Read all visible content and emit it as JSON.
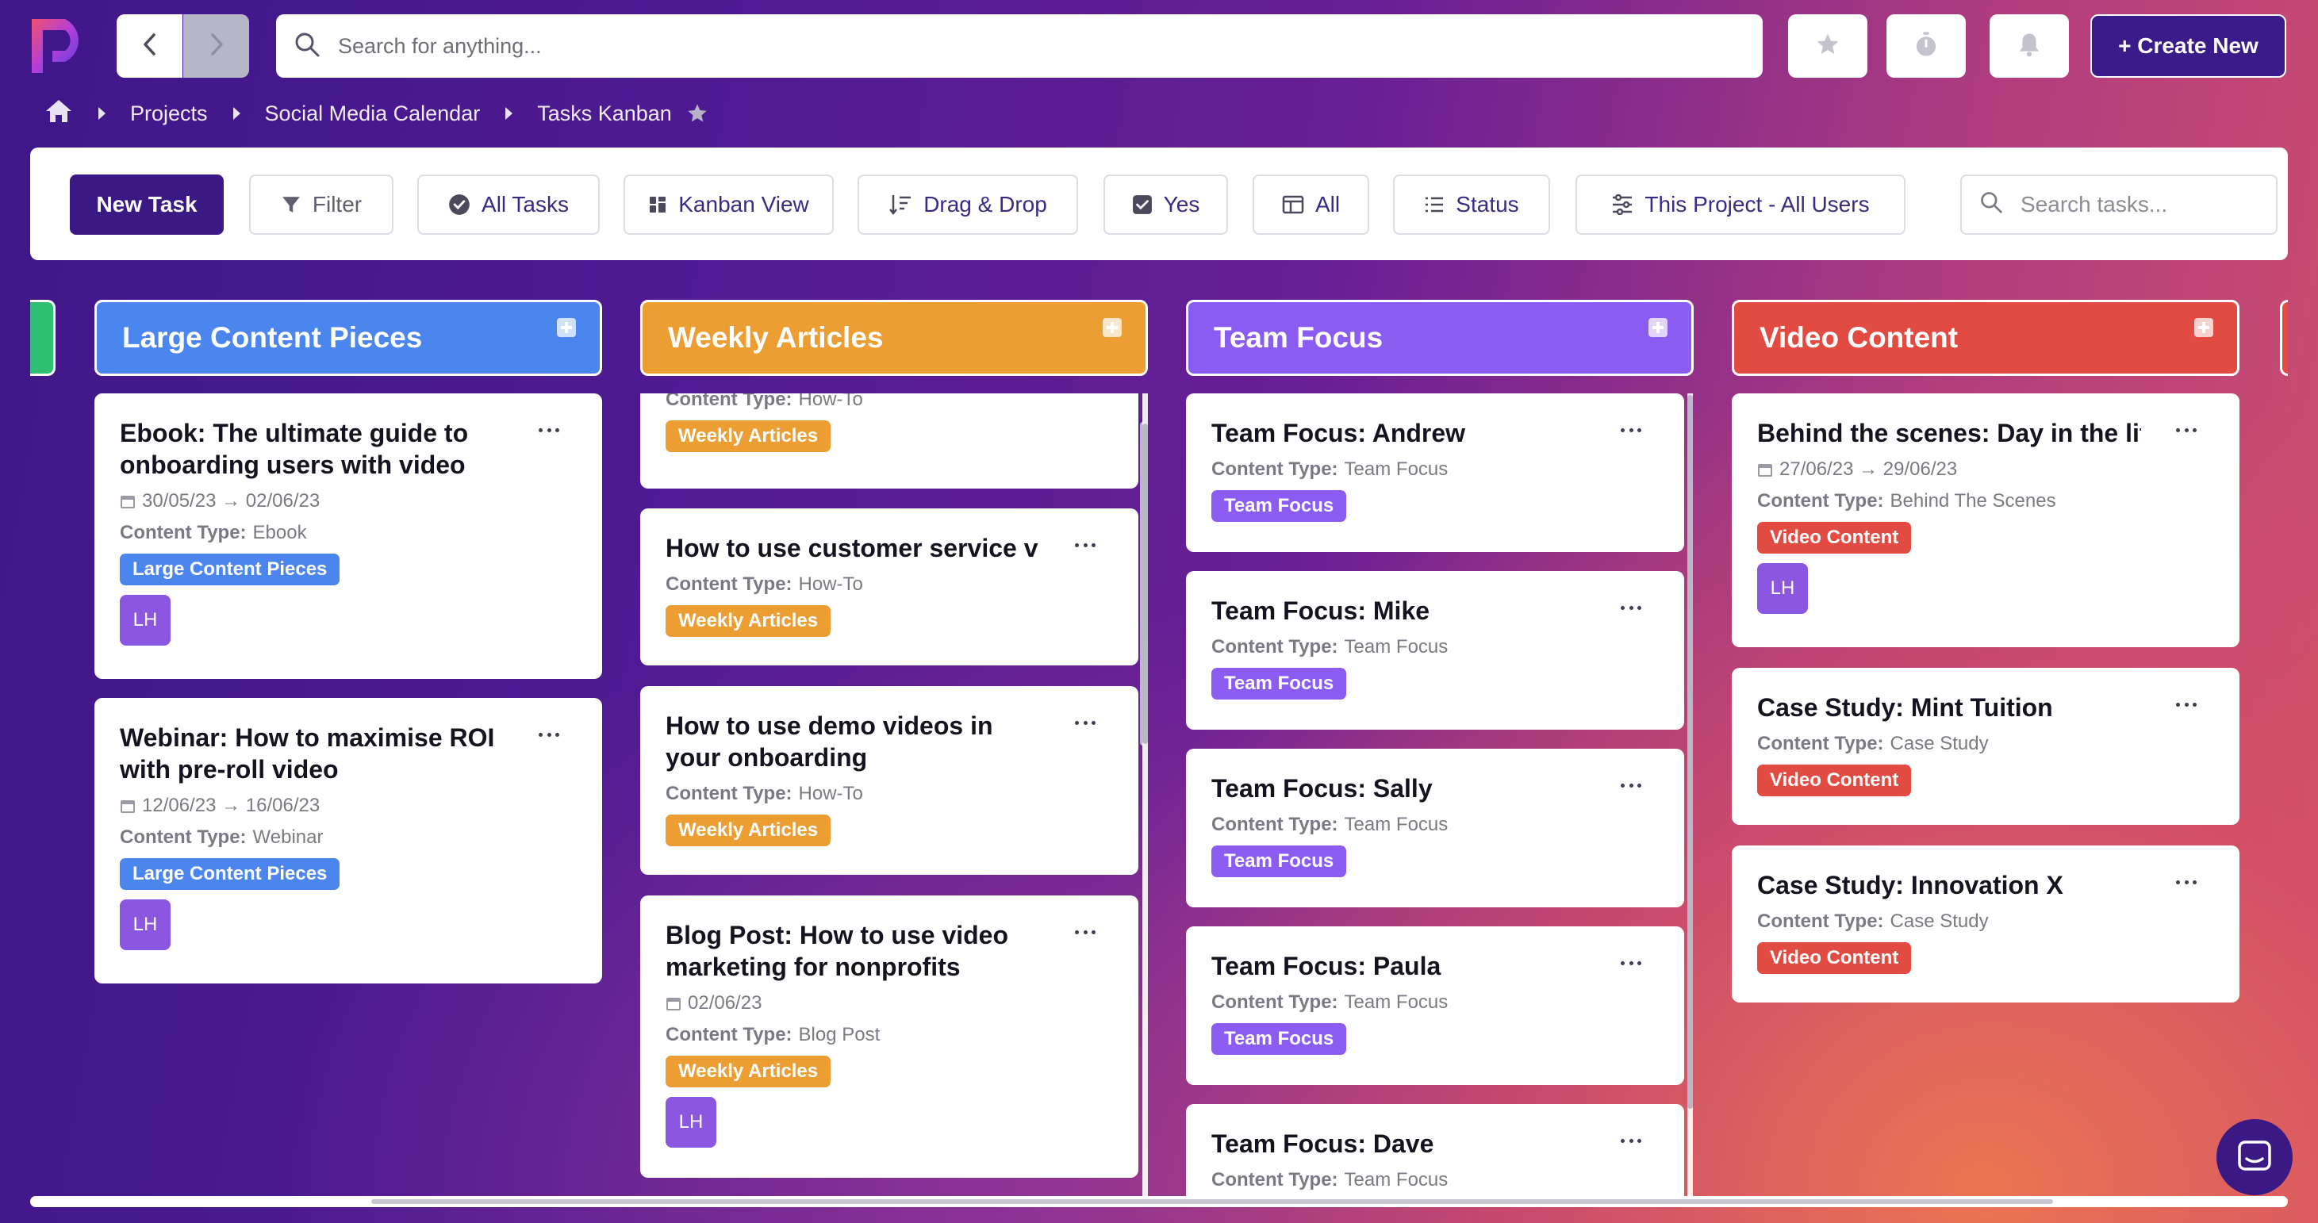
{
  "header": {
    "search_placeholder": "Search for anything...",
    "create_label": "+ Create New"
  },
  "breadcrumb": {
    "items": [
      "Projects",
      "Social Media Calendar",
      "Tasks Kanban"
    ]
  },
  "toolbar": {
    "new_task": "New Task",
    "filter": "Filter",
    "all_tasks": "All Tasks",
    "kanban_view": "Kanban View",
    "drag_drop": "Drag & Drop",
    "yes": "Yes",
    "all": "All",
    "status": "Status",
    "scope": "This Project - All Users",
    "search_placeholder": "Search tasks..."
  },
  "labels": {
    "content_type": "Content Type:"
  },
  "colors": {
    "large": "#4b86ee",
    "weekly": "#ec9e32",
    "team": "#8a5cf2",
    "video": "#e24b41",
    "peek_left": "#2fbf72",
    "brand": "#3a1985"
  },
  "columns": [
    {
      "title": "Large Content Pieces",
      "cards": [
        {
          "title": "Ebook: The ultimate guide to onboarding users with video",
          "dates": "30/05/23 → 02/06/23",
          "type": "Ebook",
          "tag": "Large Content Pieces",
          "avatar": "LH"
        },
        {
          "title": "Webinar: How to maximise ROI with pre-roll video",
          "dates": "12/06/23 → 16/06/23",
          "type": "Webinar",
          "tag": "Large Content Pieces",
          "avatar": "LH"
        }
      ]
    },
    {
      "title": "Weekly Articles",
      "cards": [
        {
          "type": "How-To",
          "tag": "Weekly Articles"
        },
        {
          "title": "How to use customer service videos",
          "type": "How-To",
          "tag": "Weekly Articles"
        },
        {
          "title": "How to use demo videos in your onboarding",
          "type": "How-To",
          "tag": "Weekly Articles"
        },
        {
          "title": "Blog Post: How to use video marketing for nonprofits",
          "dates": "02/06/23",
          "type": "Blog Post",
          "tag": "Weekly Articles",
          "avatar": "LH"
        }
      ]
    },
    {
      "title": "Team Focus",
      "cards": [
        {
          "title": "Team Focus: Andrew",
          "type": "Team Focus",
          "tag": "Team Focus"
        },
        {
          "title": "Team Focus: Mike",
          "type": "Team Focus",
          "tag": "Team Focus"
        },
        {
          "title": "Team Focus: Sally",
          "type": "Team Focus",
          "tag": "Team Focus"
        },
        {
          "title": "Team Focus: Paula",
          "type": "Team Focus",
          "tag": "Team Focus"
        },
        {
          "title": "Team Focus: Dave",
          "type": "Team Focus"
        }
      ]
    },
    {
      "title": "Video Content",
      "cards": [
        {
          "title": "Behind the scenes: Day in the life",
          "dates": "27/06/23 → 29/06/23",
          "type": "Behind The Scenes",
          "tag": "Video Content",
          "avatar": "LH"
        },
        {
          "title": "Case Study: Mint Tuition",
          "type": "Case Study",
          "tag": "Video Content"
        },
        {
          "title": "Case Study: Innovation X",
          "type": "Case Study",
          "tag": "Video Content"
        }
      ]
    }
  ]
}
